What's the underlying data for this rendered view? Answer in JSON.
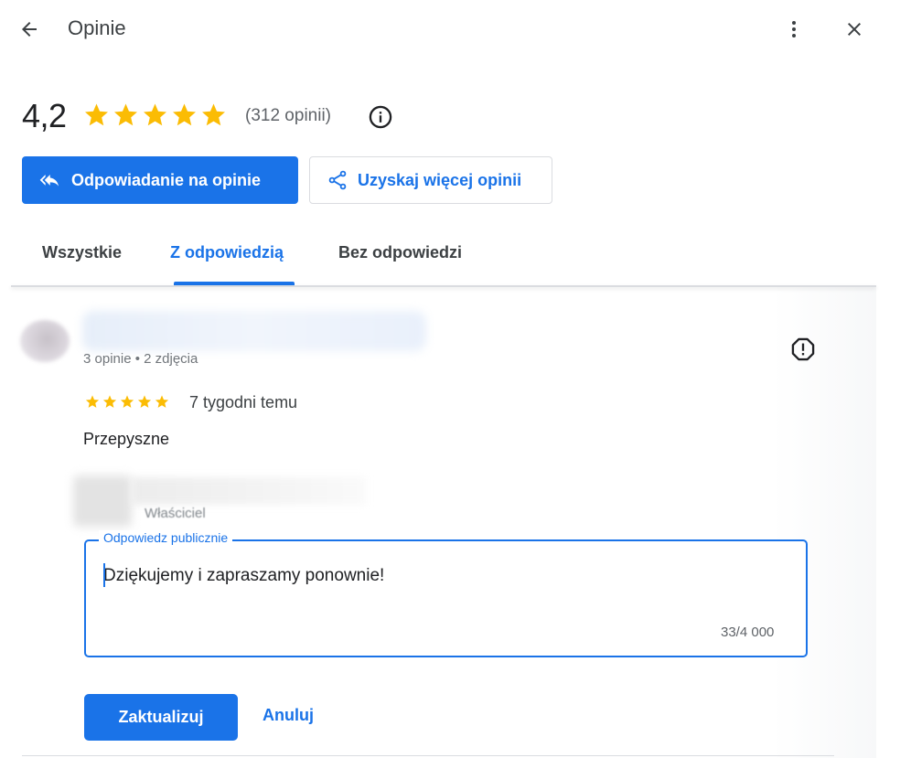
{
  "header": {
    "title": "Opinie",
    "icons": {
      "back": "arrow-back-icon",
      "more": "more-vert-icon",
      "close": "close-icon"
    }
  },
  "summary": {
    "rating": "4,2",
    "stars": 5,
    "review_count": "(312 opinii)",
    "star_color": "#fbbc04"
  },
  "actions": {
    "reply_button": "Odpowiadanie na opinie",
    "get_more_button": "Uzyskaj więcej opinii"
  },
  "tabs": [
    {
      "label": "Wszystkie",
      "active": false
    },
    {
      "label": "Z odpowiedzią",
      "active": true
    },
    {
      "label": "Bez odpowiedzi",
      "active": false
    }
  ],
  "review": {
    "meta": "3 opinie • 2 zdjęcia",
    "stars": 5,
    "time": "7 tygodni temu",
    "text": "Przepyszne"
  },
  "owner_reply": {
    "role": "Właściciel",
    "field_label": "Odpowiedz publicznie",
    "value": "Dziękujemy i zapraszamy ponownie!",
    "char_count": "33/4 000"
  },
  "buttons": {
    "update": "Zaktualizuj",
    "cancel": "Anuluj"
  },
  "colors": {
    "accent": "#1a73e8",
    "text": "#202124",
    "secondary_text": "#5f6368",
    "divider": "#dadce0"
  }
}
